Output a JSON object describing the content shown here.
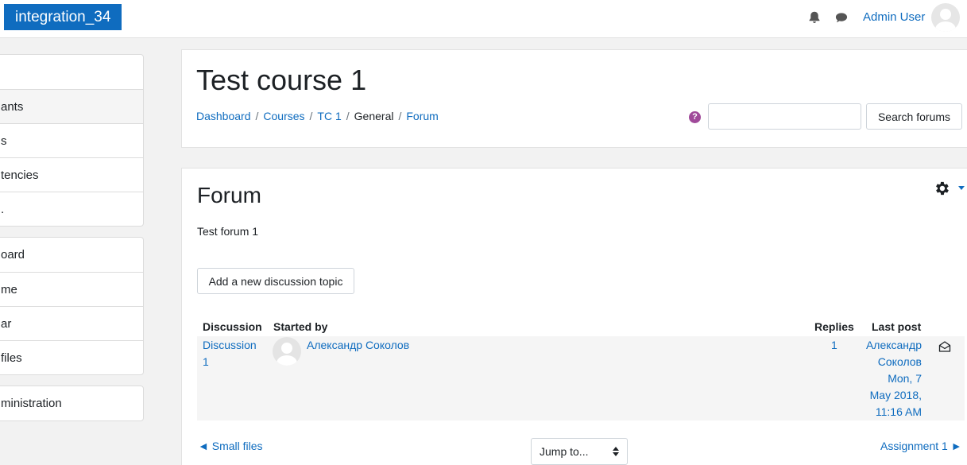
{
  "navbar": {
    "brand": "integration_34",
    "user_name": "Admin User",
    "icons": [
      "bell-icon",
      "chat-icon",
      "user-avatar"
    ]
  },
  "drawer": {
    "group1": [
      {
        "label": "ants",
        "active": true
      },
      {
        "label": "s"
      },
      {
        "label": "tencies"
      },
      {
        "label": "."
      }
    ],
    "group2": [
      {
        "label": "oard"
      },
      {
        "label": "me"
      },
      {
        "label": "ar"
      },
      {
        "label": " files"
      }
    ],
    "group3": [
      {
        "label": "ministration"
      }
    ]
  },
  "header": {
    "title": "Test course 1",
    "breadcrumb": [
      "Dashboard",
      "Courses",
      "TC 1",
      "General",
      "Forum"
    ],
    "search_placeholder": "",
    "search_button": "Search forums"
  },
  "forum": {
    "title": "Forum",
    "intro": "Test forum 1",
    "add_button": "Add a new discussion topic",
    "columns": {
      "discussion": "Discussion",
      "started_by": "Started by",
      "replies": "Replies",
      "last_post": "Last post"
    },
    "row": {
      "discussion_line1": "Discussion",
      "discussion_line2": "1",
      "started_by": "Александр Соколов",
      "replies": "1",
      "last_post_line1": "Александр",
      "last_post_line2": "Соколов",
      "last_post_line3": "Mon, 7",
      "last_post_line4": "May 2018,",
      "last_post_line5": "11:16 AM"
    }
  },
  "footer_nav": {
    "prev": "◄ Small files",
    "jump": "Jump to...",
    "next": "Assignment 1 ►"
  },
  "colors": {
    "brand": "#0f6cbf",
    "link": "#0f6cbf",
    "help": "#a04a9a"
  }
}
